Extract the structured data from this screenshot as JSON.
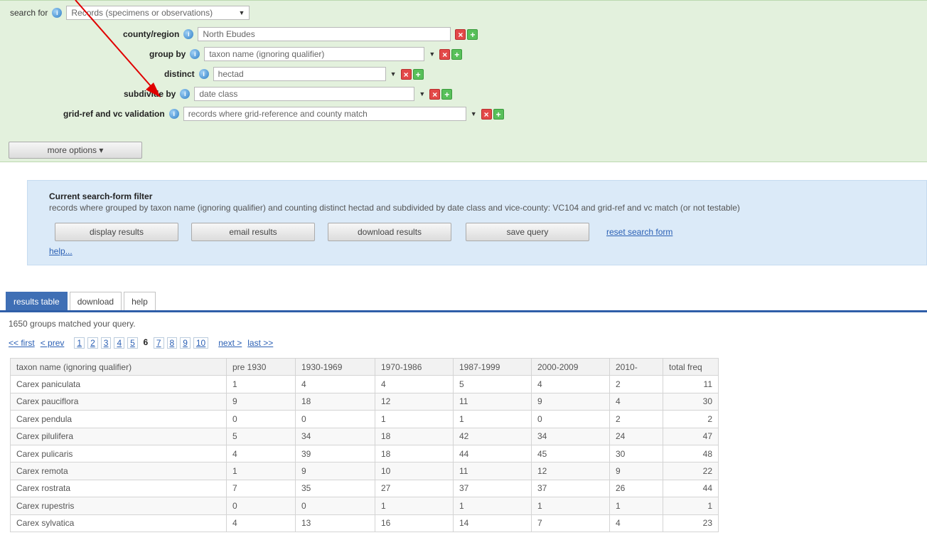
{
  "search": {
    "search_for_label": "search for",
    "search_for_value": "Records (specimens or observations)",
    "rows": [
      {
        "label": "county/region",
        "value": "North Ebudes"
      },
      {
        "label": "group by",
        "value": "taxon name (ignoring qualifier)"
      },
      {
        "label": "distinct",
        "value": "hectad"
      },
      {
        "label": "subdivide by",
        "value": "date class"
      },
      {
        "label": "grid-ref and vc validation",
        "value": "records where grid-reference and county match"
      }
    ],
    "more_options_label": "more options ▾"
  },
  "filter": {
    "title": "Current search-form filter",
    "description": "records where grouped by taxon name (ignoring qualifier) and counting distinct hectad and subdivided by date class and vice-county: VC104 and grid-ref and vc match (or not testable)",
    "buttons": [
      "display results",
      "email results",
      "download results",
      "save query"
    ],
    "reset_link": "reset search form",
    "help_link": "help..."
  },
  "tabs": [
    "results table",
    "download",
    "help"
  ],
  "results": {
    "summary": "1650 groups matched your query.",
    "pager": {
      "first": "<< first",
      "prev": "< prev",
      "pages": [
        "1",
        "2",
        "3",
        "4",
        "5",
        "6",
        "7",
        "8",
        "9",
        "10"
      ],
      "current_page": "6",
      "next": "next >",
      "last": "last >>"
    },
    "columns": [
      "taxon name (ignoring qualifier)",
      "pre 1930",
      "1930-1969",
      "1970-1986",
      "1987-1999",
      "2000-2009",
      "2010-",
      "total freq"
    ],
    "rows": [
      [
        "Carex paniculata",
        "1",
        "4",
        "4",
        "5",
        "4",
        "2",
        "11"
      ],
      [
        "Carex pauciflora",
        "9",
        "18",
        "12",
        "11",
        "9",
        "4",
        "30"
      ],
      [
        "Carex pendula",
        "0",
        "0",
        "1",
        "1",
        "0",
        "2",
        "2"
      ],
      [
        "Carex pilulifera",
        "5",
        "34",
        "18",
        "42",
        "34",
        "24",
        "47"
      ],
      [
        "Carex pulicaris",
        "4",
        "39",
        "18",
        "44",
        "45",
        "30",
        "48"
      ],
      [
        "Carex remota",
        "1",
        "9",
        "10",
        "11",
        "12",
        "9",
        "22"
      ],
      [
        "Carex rostrata",
        "7",
        "35",
        "27",
        "37",
        "37",
        "26",
        "44"
      ],
      [
        "Carex rupestris",
        "0",
        "0",
        "1",
        "1",
        "1",
        "1",
        "1"
      ],
      [
        "Carex sylvatica",
        "4",
        "13",
        "16",
        "14",
        "7",
        "4",
        "23"
      ]
    ]
  },
  "colors": {
    "search_panel_bg": "#e3f1dd",
    "filter_panel_bg": "#dbeaf8",
    "tab_active_bg": "#3f6fb5",
    "annotation_arrow": "#e00000"
  }
}
